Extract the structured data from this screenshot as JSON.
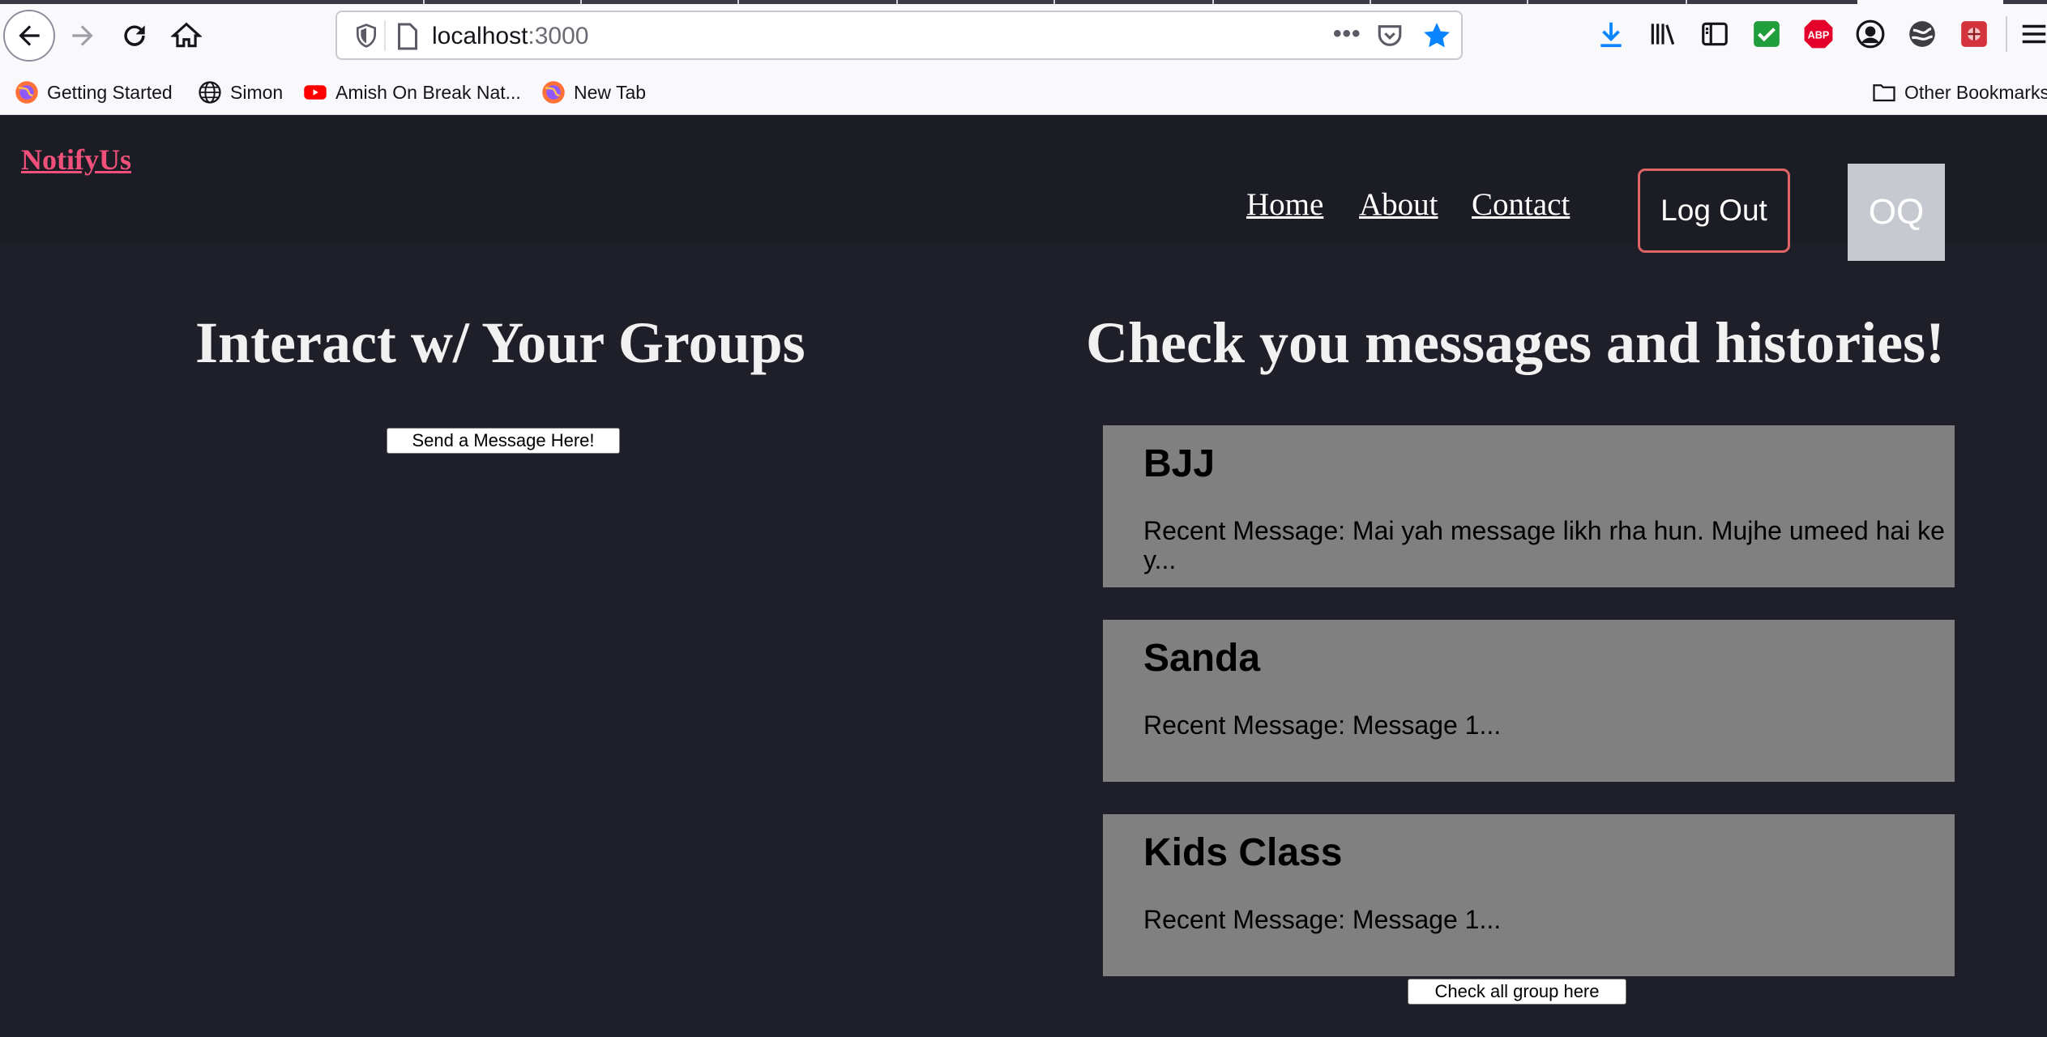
{
  "browser": {
    "url_host": "localhost",
    "url_port": ":3000",
    "more_label": "•••",
    "bookmarks": [
      {
        "label": "Getting Started",
        "icon": "firefox-icon"
      },
      {
        "label": "Simon",
        "icon": "globe-icon"
      },
      {
        "label": "Amish On Break Nat...",
        "icon": "youtube-icon"
      },
      {
        "label": "New Tab",
        "icon": "firefox-icon"
      }
    ],
    "other_bookmarks": "Other Bookmarks",
    "accent": "#0a84ff"
  },
  "app": {
    "brand": "NotifyUs",
    "nav": {
      "home": "Home",
      "about": "About",
      "contact": "Contact",
      "logout": "Log Out"
    },
    "avatar_initials": "OQ",
    "left": {
      "title": "Interact w/ Your Groups",
      "send_button": "Send a Message Here!"
    },
    "right": {
      "title": "Check you messages and histories!",
      "groups": [
        {
          "name": "BJJ",
          "message": "Recent Message: Mai yah message likh rha hun. Mujhe umeed hai ke y..."
        },
        {
          "name": "Sanda",
          "message": "Recent Message: Message 1..."
        },
        {
          "name": "Kids Class",
          "message": "Recent Message: Message 1..."
        }
      ],
      "check_all_button": "Check all group here"
    },
    "colors": {
      "background": "#1f1f29",
      "brand": "#f0507a",
      "logout_border": "#e06466",
      "card": "#808080"
    }
  }
}
